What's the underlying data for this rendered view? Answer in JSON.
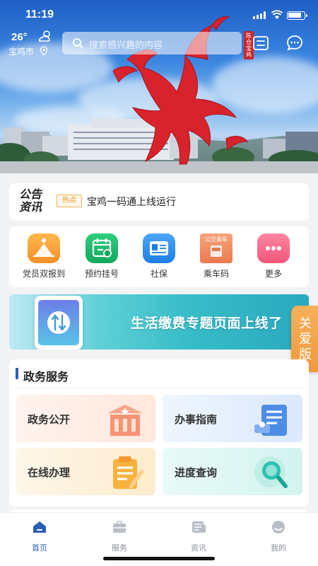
{
  "status_bar": {
    "time": "11:19"
  },
  "weather": {
    "temp": "26°",
    "city": "宝鸡市"
  },
  "search": {
    "placeholder": "搜索感兴趣的内容"
  },
  "seal_text": "陈仓宝鸡",
  "notice": {
    "logo_line1": "公告",
    "logo_line2": "资讯",
    "tag": "热点",
    "headline": "宝鸡一码通上线运行"
  },
  "quick_menu": [
    {
      "label": "党员双报到",
      "icon": "party-member-icon",
      "color": "#f59a2e"
    },
    {
      "label": "预约挂号",
      "icon": "calendar-register-icon",
      "color": "#19b96b"
    },
    {
      "label": "社保",
      "icon": "id-card-icon",
      "color": "#2d8ff0"
    },
    {
      "label": "乘车码",
      "icon": "bus-code-icon",
      "color": "#f08a5d",
      "badge": "公交乘车"
    },
    {
      "label": "更多",
      "icon": "more-icon",
      "color": "#f2668a"
    }
  ],
  "banner": {
    "text": "生活缴费专题页面上线了"
  },
  "care_mode": {
    "line1": "关",
    "line2": "爱",
    "line3": "版"
  },
  "gov_services": {
    "title": "政务服务",
    "tiles": [
      {
        "label": "政务公开",
        "icon": "government-building-icon"
      },
      {
        "label": "办事指南",
        "icon": "guide-document-icon"
      },
      {
        "label": "在线办理",
        "icon": "online-form-icon"
      },
      {
        "label": "进度查询",
        "icon": "progress-search-icon"
      }
    ]
  },
  "tabbar": [
    {
      "label": "首页",
      "icon": "home-icon",
      "active": true
    },
    {
      "label": "服务",
      "icon": "briefcase-icon"
    },
    {
      "label": "资讯",
      "icon": "news-icon"
    },
    {
      "label": "我的",
      "icon": "profile-icon"
    }
  ]
}
